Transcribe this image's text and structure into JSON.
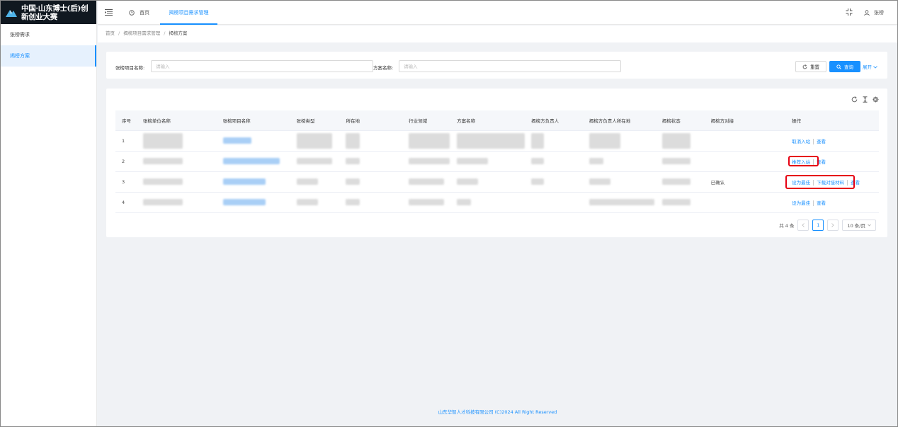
{
  "app": {
    "title_line1": "中国·山东博士(后)创",
    "title_line2": "新创业大赛"
  },
  "sidebar": {
    "items": [
      {
        "label": "张榜需求"
      },
      {
        "label": "揭榜方案"
      }
    ]
  },
  "topbar": {
    "tabs": [
      {
        "label": "首页"
      },
      {
        "label": "揭榜项目需求管理"
      }
    ],
    "user_name": "张榜"
  },
  "breadcrumb": {
    "items": [
      "首页",
      "揭榜项目需求管理",
      "揭榜方案"
    ]
  },
  "search": {
    "field1_label": "张榜项目名称:",
    "field1_placeholder": "请输入",
    "field1_value": "",
    "field2_label": "方案名称:",
    "field2_placeholder": "请输入",
    "field2_value": "",
    "reset_label": "重置",
    "query_label": "查询",
    "expand_label": "展开"
  },
  "table": {
    "columns": [
      "序号",
      "张榜单位名称",
      "张榜项目名称",
      "张榜类型",
      "所在地",
      "行业领域",
      "方案名称",
      "揭榜方负责人",
      "揭榜方负责人所在地",
      "揭榜状态",
      "揭榜方对接",
      "操作"
    ],
    "rows": [
      {
        "index": "1",
        "docking": "",
        "actions": [
          "取消入站",
          "查看"
        ]
      },
      {
        "index": "2",
        "docking": "",
        "actions": [
          "推荐入站",
          "查看"
        ]
      },
      {
        "index": "3",
        "docking": "已确认",
        "actions": [
          "设为最佳",
          "下载对接材料",
          "查看"
        ]
      },
      {
        "index": "4",
        "docking": "",
        "actions": [
          "设为最佳",
          "查看"
        ]
      }
    ]
  },
  "pagination": {
    "total_text": "共 4 条",
    "current_page": "1",
    "page_size": "10 条/页"
  },
  "footer": {
    "text": "山东华智人才科技有限公司 (C)2024 All Right Reserved"
  },
  "colors": {
    "primary": "#1890ff",
    "highlight": "#e60012",
    "logo_bg": "#101820"
  }
}
